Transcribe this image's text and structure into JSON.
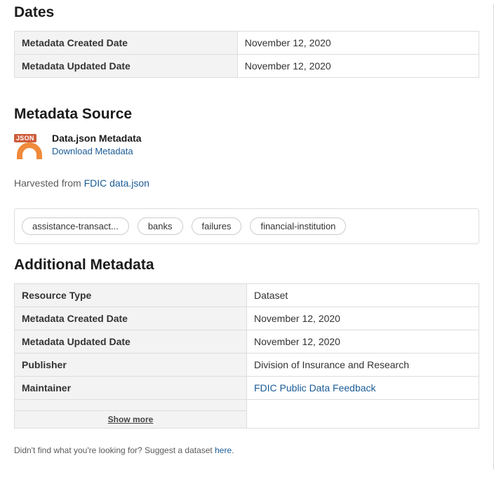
{
  "dates": {
    "heading": "Dates",
    "rows": [
      {
        "label": "Metadata Created Date",
        "value": "November 12, 2020"
      },
      {
        "label": "Metadata Updated Date",
        "value": "November 12, 2020"
      }
    ]
  },
  "metadata_source": {
    "heading": "Metadata Source",
    "title": "Data.json Metadata",
    "download_label": "Download Metadata",
    "icon_badge": "JSON",
    "harvested_prefix": "Harvested from ",
    "harvested_link": "FDIC data.json"
  },
  "tags": [
    "assistance-transact...",
    "banks",
    "failures",
    "financial-institution"
  ],
  "additional": {
    "heading": "Additional Metadata",
    "rows": [
      {
        "label": "Resource Type",
        "value": "Dataset",
        "is_link": false
      },
      {
        "label": "Metadata Created Date",
        "value": "November 12, 2020",
        "is_link": false
      },
      {
        "label": "Metadata Updated Date",
        "value": "November 12, 2020",
        "is_link": false
      },
      {
        "label": "Publisher",
        "value": "Division of Insurance and Research",
        "is_link": false
      },
      {
        "label": "Maintainer",
        "value": "FDIC Public Data Feedback",
        "is_link": true
      }
    ],
    "show_more": "Show more"
  },
  "footer": {
    "text": "Didn't find what you're looking for? Suggest a dataset ",
    "link": "here",
    "period": "."
  }
}
